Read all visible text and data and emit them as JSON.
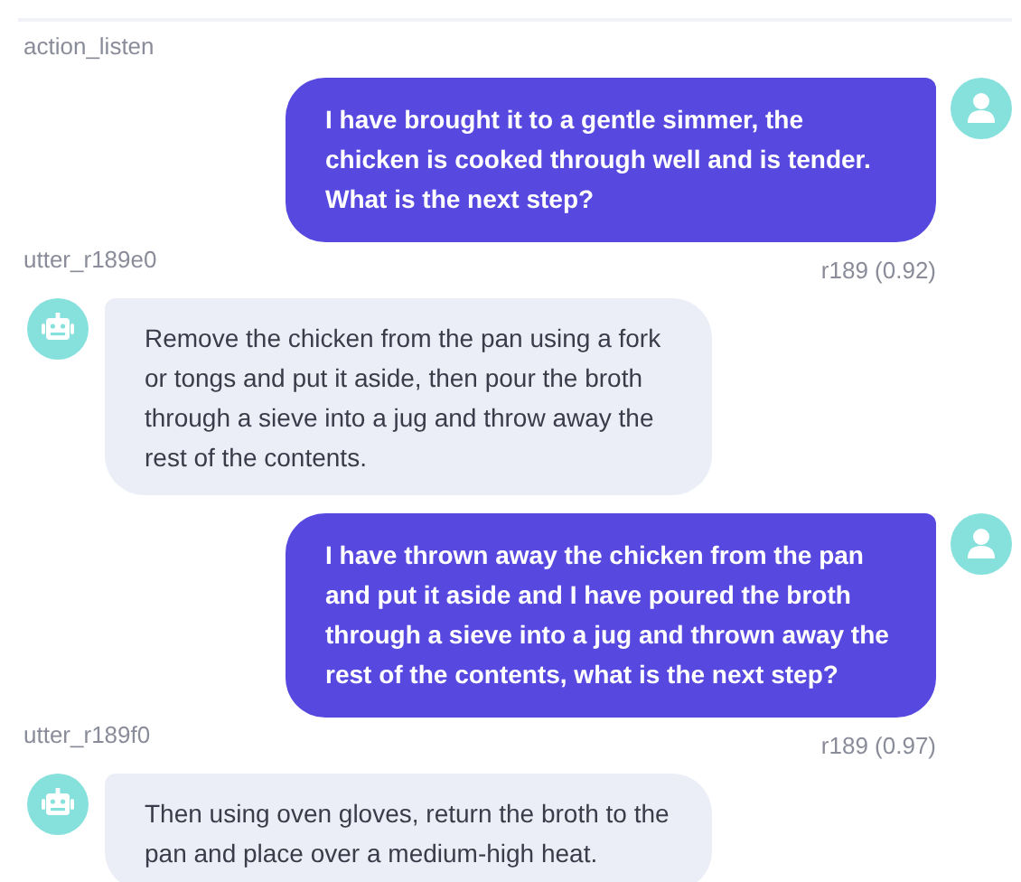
{
  "conversation": [
    {
      "kind": "action",
      "label": "action_listen"
    },
    {
      "kind": "user",
      "text": "I have brought it to a gentle simmer, the chicken is cooked through well and is tender. What is the next step?",
      "next_action": "utter_r189e0",
      "intent": "r189 (0.92)"
    },
    {
      "kind": "bot",
      "text": "Remove the chicken from the pan using a fork or tongs and put it aside, then pour the broth through a sieve into a jug and throw away the rest of the contents."
    },
    {
      "kind": "user",
      "text": "I have thrown away the chicken from the pan and put it aside and I have poured the broth through a sieve into a jug and thrown away the rest of the contents, what is the next step?",
      "next_action": "utter_r189f0",
      "intent": "r189 (0.97)"
    },
    {
      "kind": "bot",
      "text": "Then using oven gloves, return the broth to the pan and place over a medium-high heat."
    }
  ]
}
